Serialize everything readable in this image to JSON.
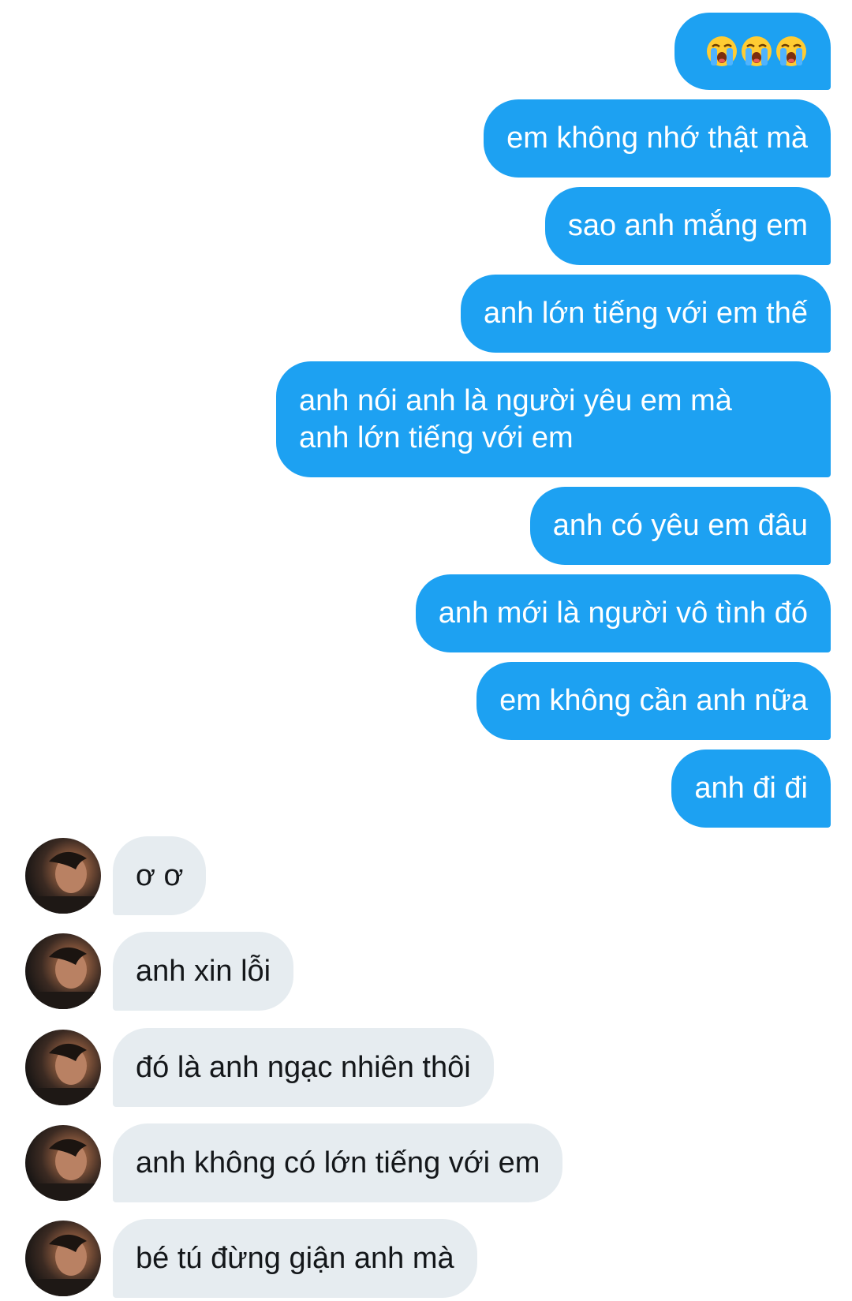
{
  "conversation": {
    "sent": [
      {
        "text": "😭😭😭",
        "icon": "loudly-crying-face-icon",
        "count": 3
      },
      {
        "text": "em không nhớ thật mà"
      },
      {
        "text": "sao anh mắng em"
      },
      {
        "text": "anh lớn tiếng với em thế"
      },
      {
        "line1": "anh nói anh là người yêu em mà",
        "line2": "anh lớn tiếng với em"
      },
      {
        "text": "anh có yêu em đâu"
      },
      {
        "text": "anh mới là người vô tình đó"
      },
      {
        "text": "em không cần anh nữa"
      },
      {
        "text": "anh đi đi"
      }
    ],
    "received": [
      {
        "text": "ơ ơ"
      },
      {
        "text": "anh xin lỗi"
      },
      {
        "text": "đó là anh ngạc nhiên thôi"
      },
      {
        "text": "anh không có lớn tiếng với em"
      },
      {
        "text": "bé tú đừng giận anh mà"
      }
    ]
  },
  "colors": {
    "sent_bubble": "#1da1f2",
    "received_bubble": "#e6ecf0",
    "received_text": "#14171a"
  }
}
